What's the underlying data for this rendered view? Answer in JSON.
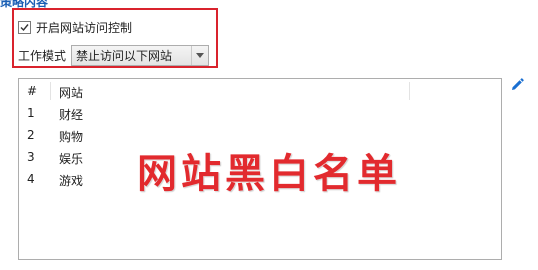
{
  "header": {
    "cut_label": "策略内容"
  },
  "settings": {
    "enable_checked": true,
    "enable_label": "开启网站访问控制",
    "mode_label": "工作模式",
    "mode_value": "禁止访问以下网站"
  },
  "table": {
    "columns": [
      "#",
      "网站"
    ],
    "rows": [
      {
        "num": "1",
        "site": "财经"
      },
      {
        "num": "2",
        "site": "购物"
      },
      {
        "num": "3",
        "site": "娱乐"
      },
      {
        "num": "4",
        "site": "游戏"
      }
    ]
  },
  "overlay": {
    "title": "网站黑白名单"
  },
  "icons": {
    "edit": "pencil-edit-icon",
    "checkbox": "checkmark-icon",
    "dropdown": "chevron-down-icon"
  },
  "colors": {
    "highlight": "#d9232d",
    "overlay_text": "#e22a2e",
    "accent": "#1a6fd1"
  }
}
